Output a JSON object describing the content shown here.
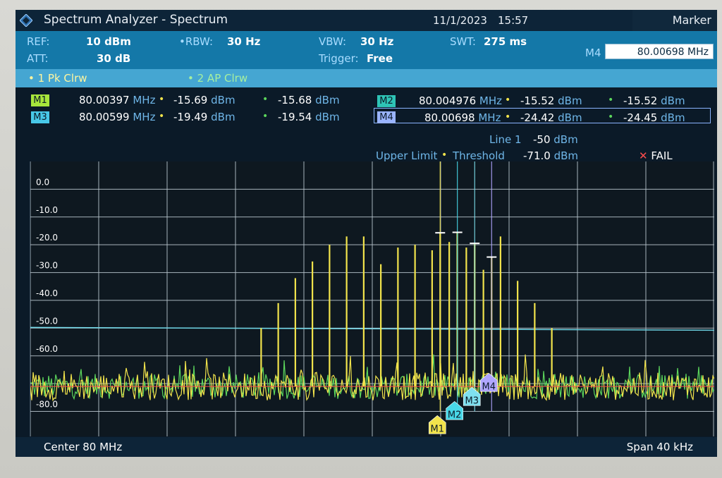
{
  "window": {
    "title": "Spectrum Analyzer - Spectrum",
    "date": "11/1/2023",
    "time": "15:57",
    "marker_button": "Marker"
  },
  "settings": {
    "ref_label": "REF:",
    "ref_value": "10 dBm",
    "att_label": "ATT:",
    "att_value": "30 dB",
    "rbw_label": "RBW:",
    "rbw_value": "30 Hz",
    "vbw_label": "VBW:",
    "vbw_value": "30 Hz",
    "trigger_label": "Trigger:",
    "trigger_value": "Free",
    "swt_label": "SWT:",
    "swt_value": "275 ms",
    "marker_entry_label": "M4",
    "marker_entry_value": "80.00698 MHz"
  },
  "traces": {
    "trace1": "1 Pk Clrw",
    "trace2": "2 AP Clrw"
  },
  "markers": [
    {
      "label": "M1",
      "freq": "80.00397",
      "freq_unit": "MHz",
      "level1": "-15.69",
      "level2": "-15.68",
      "level_unit": "dBm",
      "color": "#a8e63c"
    },
    {
      "label": "M3",
      "freq": "80.00599",
      "freq_unit": "MHz",
      "level1": "-19.49",
      "level2": "-19.54",
      "level_unit": "dBm",
      "color": "#48c8e8"
    },
    {
      "label": "M2",
      "freq": "80.004976",
      "freq_unit": "MHz",
      "level1": "-15.52",
      "level2": "-15.52",
      "level_unit": "dBm",
      "color": "#2ec4b6"
    },
    {
      "label": "M4",
      "freq": "80.00698",
      "freq_unit": "MHz",
      "level1": "-24.42",
      "level2": "-24.45",
      "level_unit": "dBm",
      "color": "#9ab4ff"
    }
  ],
  "limits": {
    "line_label": "Line 1",
    "line_value": "-50",
    "line_unit": "dBm",
    "upper_limit_label": "Upper Limit",
    "threshold_label": "Threshold",
    "threshold_value": "-71.0",
    "threshold_unit": "dBm",
    "fail_label": "FAIL"
  },
  "footer": {
    "center": "Center 80 MHz",
    "span": "Span 40 kHz"
  },
  "colors": {
    "trace1": "#f2e44c",
    "trace2": "#5cd65c",
    "line1": "#6ed6e6",
    "threshold": "#ff4d4d"
  },
  "chart_data": {
    "type": "line",
    "yticks": [
      "0.0",
      "-10.0",
      "-20.0",
      "-30.0",
      "-40.0",
      "-50.0",
      "-60.0",
      "",
      "-80.0"
    ],
    "ylim": [
      -89,
      10
    ],
    "xlim": [
      79.98,
      80.02
    ],
    "x_unit": "MHz",
    "y_unit": "dBm",
    "grid": true,
    "limit_line_db": -50,
    "threshold_db": -71.0,
    "noise_floor_db": -71,
    "peaks": [
      {
        "x": 79.9935,
        "y": -50
      },
      {
        "x": 79.9945,
        "y": -41
      },
      {
        "x": 79.9955,
        "y": -32
      },
      {
        "x": 79.9965,
        "y": -26
      },
      {
        "x": 79.9975,
        "y": -20
      },
      {
        "x": 79.9985,
        "y": -17
      },
      {
        "x": 79.9995,
        "y": -17
      },
      {
        "x": 80.0005,
        "y": -27
      },
      {
        "x": 80.0015,
        "y": -21
      },
      {
        "x": 80.0025,
        "y": -20
      },
      {
        "x": 80.0035,
        "y": -22
      },
      {
        "x": 80.0045,
        "y": -19
      },
      {
        "x": 80.0055,
        "y": -21
      },
      {
        "x": 80.0065,
        "y": -29
      },
      {
        "x": 80.0075,
        "y": -17
      },
      {
        "x": 80.00397,
        "y": -15.69
      },
      {
        "x": 80.00497,
        "y": -15.52
      },
      {
        "x": 80.00599,
        "y": -19.49
      },
      {
        "x": 80.00698,
        "y": -24.42
      },
      {
        "x": 80.0085,
        "y": -33
      },
      {
        "x": 80.0095,
        "y": -41
      },
      {
        "x": 80.0105,
        "y": -50
      }
    ],
    "marker_x": [
      {
        "label": "M1",
        "x": 80.00397,
        "y": -15.69,
        "color": "#f2e44c"
      },
      {
        "label": "M2",
        "x": 80.004976,
        "y": -15.52,
        "color": "#48d8e8"
      },
      {
        "label": "M3",
        "x": 80.00599,
        "y": -19.49,
        "color": "#7fe0ef"
      },
      {
        "label": "M4",
        "x": 80.00698,
        "y": -24.42,
        "color": "#b0a6ff"
      }
    ]
  }
}
